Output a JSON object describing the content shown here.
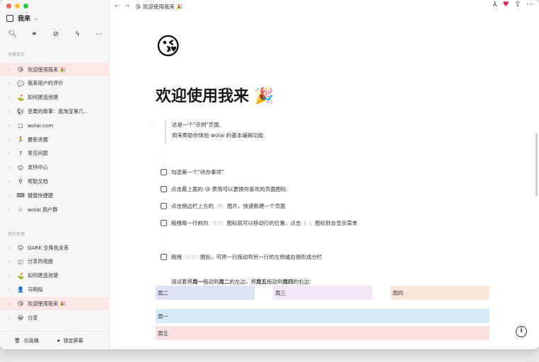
{
  "workspace": {
    "name": "我来"
  },
  "sidebar": {
    "favorites_title": "收藏首页",
    "favorites": [
      {
        "icon": "😘",
        "label": "欢迎使用我来 🎉",
        "active": true
      },
      {
        "icon": "💬",
        "label": "我来用户的评价"
      },
      {
        "icon": "⛳",
        "label": "如何建造池塘"
      },
      {
        "icon": "🐿",
        "label": "坚果的故事：我淘宝第几…"
      },
      {
        "icon": "▢",
        "label": "wolai.com"
      },
      {
        "icon": "🏃",
        "label": "最新进展"
      },
      {
        "icon": "?",
        "label": "常见问题"
      },
      {
        "icon": "☺",
        "label": "支持中心"
      },
      {
        "icon": "⚲",
        "label": "帮助文档"
      },
      {
        "icon": "⌨",
        "label": "键盘快捷键"
      },
      {
        "icon": "♧",
        "label": "wolai 用户群"
      }
    ],
    "pages_title": "我的页面",
    "pages": [
      {
        "icon": "☺",
        "label": "DARK 全角色关系"
      },
      {
        "icon": "📰",
        "label": "分享的收曲"
      },
      {
        "icon": "⛳",
        "label": "如何建造池塘"
      },
      {
        "icon": "👤",
        "label": "马明拟"
      },
      {
        "icon": "😘",
        "label": "欢迎使用我来 🎉",
        "active": true
      },
      {
        "icon": "😀",
        "label": "分享"
      }
    ],
    "footer": {
      "trash": "垃圾桶",
      "lock": "锁定屏幕"
    }
  },
  "topbar": {
    "breadcrumb": "欢迎使用我来 🎉",
    "page_icon": "😘"
  },
  "page": {
    "emoji": "😘",
    "title": "欢迎使用我来 🎉",
    "quote_line1": "这是一个\"示例\"页面,",
    "quote_line2": "用来帮助你体验 wolai 的基本编辑功能",
    "todos": [
      {
        "pre": "勾选第一个\"待办事项\"",
        "badge": "",
        "post": ""
      },
      {
        "pre": "点击最上面的 😘 表情可以更换你喜欢的页面图标",
        "badge": "",
        "post": ""
      },
      {
        "pre": "点击侧边栏上方的",
        "badge": "+",
        "post": "图片，快速新建一个页面"
      },
      {
        "pre": "拖拽每一行前的",
        "badge": "⋮⋮",
        "post": "图标就可以移动行的位置，点击 ⋮⋮ 图标则会显示菜单"
      }
    ],
    "drag_pre": "拖拽",
    "drag_badge": "⋮⋮",
    "drag_post": "图标，可将一行拖动到另一行的左侧或右侧形成分栏",
    "line2_a": "请试着将",
    "line2_b": "周一",
    "line2_c": "拖动到",
    "line2_d": "周二",
    "line2_e": "的左边，将",
    "line2_f": "周五",
    "line2_g": "拖动到",
    "line2_h": "周四",
    "line2_i": "的右边：",
    "columns": [
      {
        "label": "周二",
        "color": "#dfe3f7"
      },
      {
        "label": "周三",
        "color": "#f2e8f7"
      },
      {
        "label": "周四",
        "color": "#fbe6dc"
      }
    ],
    "rows": [
      {
        "label": "周一",
        "color": "#d8ebf8"
      },
      {
        "label": "周五",
        "color": "#fbe1e1"
      }
    ]
  },
  "colors": {
    "active_bg": "#fde8e8",
    "traffic": [
      "#fe5f57",
      "#febc2e",
      "#28c840"
    ]
  }
}
